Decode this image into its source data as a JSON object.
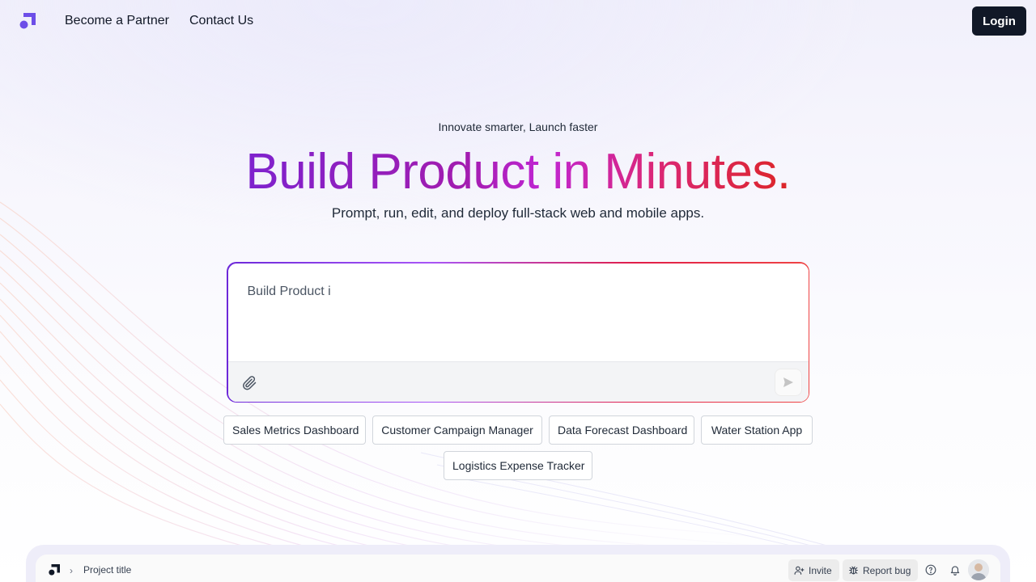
{
  "header": {
    "nav": {
      "partner": "Become a Partner",
      "contact": "Contact Us"
    },
    "login_label": "Login"
  },
  "hero": {
    "tagline": "Innovate smarter, Launch faster",
    "headline": "Build Product in Minutes.",
    "subline": "Prompt, run, edit, and deploy full-stack web and mobile apps."
  },
  "prompt": {
    "value": "Build Product i"
  },
  "suggestions": [
    "Sales Metrics Dashboard",
    "Customer Campaign Manager",
    "Data Forecast Dashboard",
    "Water Station App",
    "Logistics Expense Tracker"
  ],
  "preview": {
    "project_title": "Project title",
    "invite_label": "Invite",
    "report_label": "Report bug"
  },
  "colors": {
    "brand": "#6d4ee8",
    "login_bg": "#111827",
    "gradient_start": "#7e22ce",
    "gradient_end": "#dc2626"
  },
  "icons": [
    "logo-icon",
    "paperclip-icon",
    "send-icon",
    "chevron-right-icon",
    "user-plus-icon",
    "bug-icon",
    "help-icon",
    "bell-icon"
  ]
}
